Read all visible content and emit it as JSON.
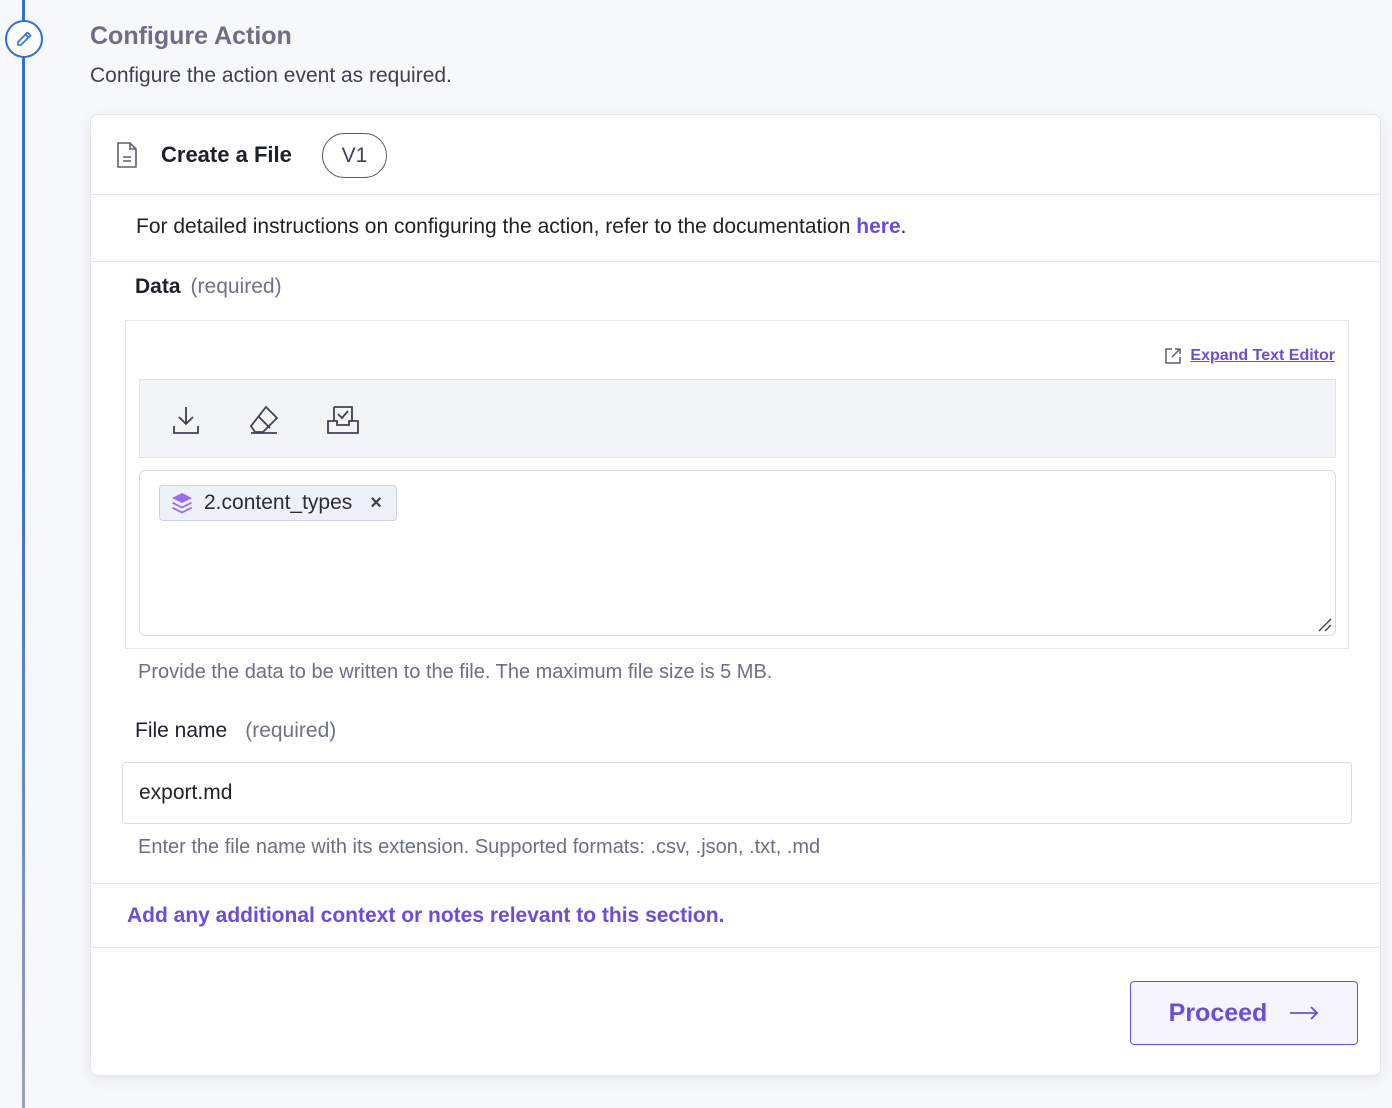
{
  "section": {
    "title": "Configure Action",
    "subtitle": "Configure the action event as required."
  },
  "card": {
    "title": "Create a File",
    "version": "V1",
    "doc_text": "For detailed instructions on configuring the action, refer to the documentation ",
    "doc_link": "here",
    "doc_suffix": "."
  },
  "data_field": {
    "label": "Data",
    "required": "(required)",
    "expand_label": "Expand Text Editor",
    "chip_label": "2.content_types",
    "chip_close": "×",
    "help": "Provide the data to be written to the file. The maximum file size is 5 MB.",
    "toolbar_icons": [
      "download-icon",
      "eraser-icon",
      "inbox-check-icon"
    ]
  },
  "file_name_field": {
    "label": "File name",
    "required": "(required)",
    "value": "export.md",
    "help": "Enter the file name with its extension. Supported formats: .csv, .json, .txt, .md"
  },
  "notes": {
    "label": "Add any additional context or notes relevant to this section."
  },
  "actions": {
    "proceed_label": "Proceed",
    "proceed_arrow": "⟶"
  },
  "colors": {
    "accent": "#6c4cdb",
    "timeline": "#2f6fd6",
    "chip_icon": "#9b6cf0"
  }
}
